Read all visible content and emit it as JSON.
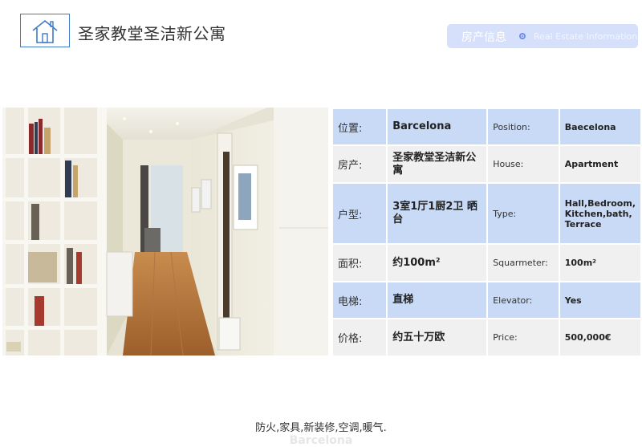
{
  "header": {
    "title": "圣家教堂圣洁新公寓",
    "badge_cn": "房产信息",
    "badge_en": "Real Estate Information"
  },
  "icons": {
    "logo": "house-icon",
    "badge": "target-dot-icon"
  },
  "photo": {
    "semantic": "hallway-interior-photo"
  },
  "table": {
    "rows": [
      {
        "label_cn": "位置:",
        "value_cn": "Barcelona",
        "label_en": "Position:",
        "value_en": "Baecelona"
      },
      {
        "label_cn": "房产:",
        "value_cn": "圣家教堂圣洁新公寓",
        "label_en": "House:",
        "value_en": "Apartment"
      },
      {
        "label_cn": "户型:",
        "value_cn": "3室1厅1厨2卫 晒台",
        "label_en": "Type:",
        "value_en": "Hall,Bedroom, Kitchen,bath, Terrace"
      },
      {
        "label_cn": "面积:",
        "value_cn": "约100m²",
        "label_en": "Squarmeter:",
        "value_en": "100m²"
      },
      {
        "label_cn": "电梯:",
        "value_cn": "直梯",
        "label_en": "Elevator:",
        "value_en": "Yes"
      },
      {
        "label_cn": "价格:",
        "value_cn": "约五十万欧",
        "label_en": "Price:",
        "value_en": "500,000€"
      }
    ]
  },
  "footer": {
    "note": "防火,家具,新装修,空调,暖气.",
    "partial_text": "Barcelona"
  },
  "colors": {
    "accent": "#3e79c8",
    "row_blue": "#c9daf6",
    "row_gray": "#f0f0f0",
    "badge_bg": "#d6e0fb"
  }
}
